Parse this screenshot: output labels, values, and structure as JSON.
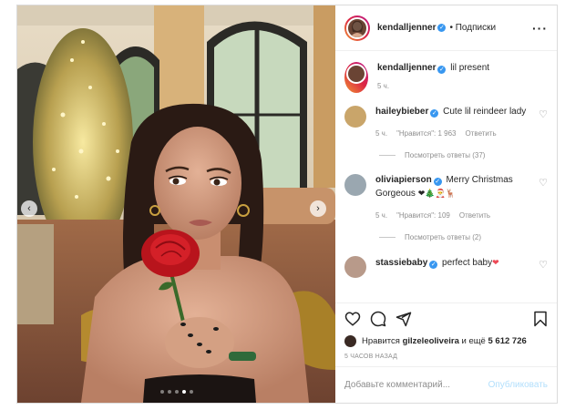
{
  "header": {
    "username": "kendalljenner",
    "follow_status": "• Подписки",
    "more_icon": "more-dots-icon"
  },
  "caption": {
    "username": "kendalljenner",
    "text": "lil present",
    "time": "5 ч."
  },
  "comments": [
    {
      "username": "haileybieber",
      "text": "Cute lil reindeer lady",
      "time": "5 ч.",
      "likes": "\"Нравится\": 1 963",
      "reply_label": "Ответить",
      "view_replies": "Посмотреть ответы (37)"
    },
    {
      "username": "oliviapierson",
      "text": "Merry Christmas Gorgeous",
      "emoji": "❤🎄🎅🦌",
      "time": "5 ч.",
      "likes": "\"Нравится\": 109",
      "reply_label": "Ответить",
      "view_replies": "Посмотреть ответы (2)"
    },
    {
      "username": "stassiebaby",
      "text": "perfect baby",
      "emoji": "❤"
    }
  ],
  "likes": {
    "prefix": "Нравится",
    "user": "gilzeleoliveira",
    "middle": "и ещё",
    "count": "5 612 726"
  },
  "time_ago": "5 ЧАСОВ НАЗАД",
  "add_comment": {
    "placeholder": "Добавьте комментарий...",
    "publish_label": "Опубликовать"
  },
  "carousel": {
    "slide_count": 5,
    "active_index": 3
  },
  "colors": {
    "verified": "#3897f0",
    "heart": "#ed4956",
    "publish": "#b2dffc"
  }
}
